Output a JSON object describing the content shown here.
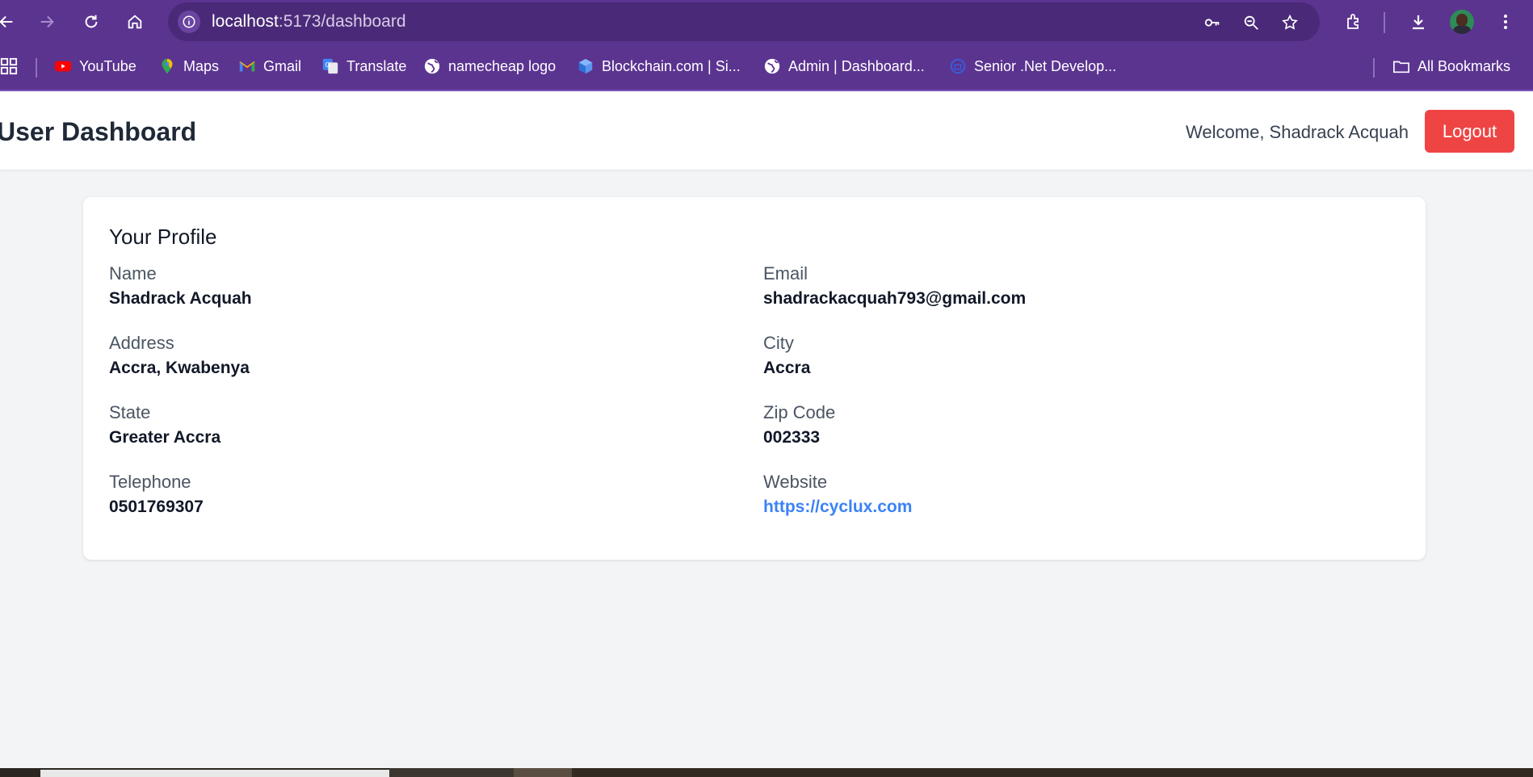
{
  "browser": {
    "url_host": "localhost",
    "url_path": ":5173/dashboard",
    "bookmarks": [
      {
        "label": "YouTube",
        "icon": "youtube-icon"
      },
      {
        "label": "Maps",
        "icon": "maps-icon"
      },
      {
        "label": "Gmail",
        "icon": "gmail-icon"
      },
      {
        "label": "Translate",
        "icon": "translate-icon"
      },
      {
        "label": "namecheap logo",
        "icon": "globe-icon"
      },
      {
        "label": "Blockchain.com | Si...",
        "icon": "blockchain-icon"
      },
      {
        "label": "Admin | Dashboard...",
        "icon": "globe-icon"
      },
      {
        "label": "Senior .Net Develop...",
        "icon": "job-icon"
      }
    ],
    "all_bookmarks_label": "All Bookmarks"
  },
  "header": {
    "title": "User Dashboard",
    "welcome": "Welcome, Shadrack Acquah",
    "logout_label": "Logout"
  },
  "profile": {
    "title": "Your Profile",
    "fields": [
      {
        "label": "Name",
        "value": "Shadrack Acquah"
      },
      {
        "label": "Email",
        "value": "shadrackacquah793@gmail.com"
      },
      {
        "label": "Address",
        "value": "Accra, Kwabenya"
      },
      {
        "label": "City",
        "value": "Accra"
      },
      {
        "label": "State",
        "value": "Greater Accra"
      },
      {
        "label": "Zip Code",
        "value": "002333"
      },
      {
        "label": "Telephone",
        "value": "0501769307"
      },
      {
        "label": "Website",
        "value": "https://cyclux.com"
      }
    ]
  },
  "colors": {
    "chrome": "#5b3490",
    "logout": "#ef4444",
    "link": "#3b82f6",
    "page_bg": "#f3f4f6"
  }
}
